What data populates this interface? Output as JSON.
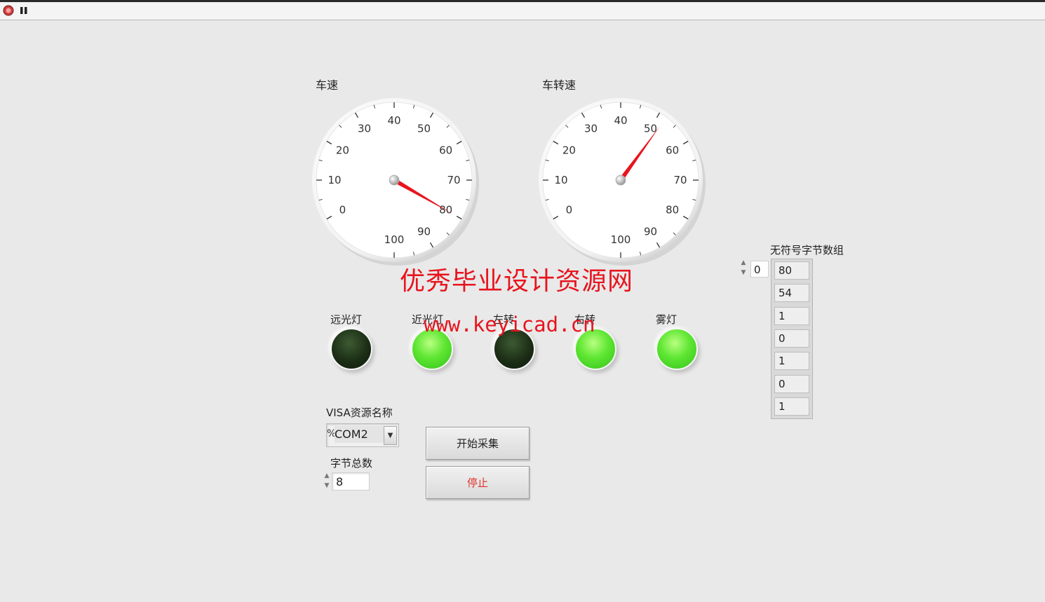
{
  "gauges": [
    {
      "id": "speed",
      "label": "车速",
      "min": 0,
      "max": 100,
      "value": 80,
      "ticks": [
        "0",
        "10",
        "20",
        "30",
        "40",
        "50",
        "60",
        "70",
        "80",
        "90",
        "100"
      ],
      "needle_color": "#e8141e"
    },
    {
      "id": "rpm",
      "label": "车转速",
      "min": 0,
      "max": 100,
      "value": 52,
      "ticks": [
        "0",
        "10",
        "20",
        "30",
        "40",
        "50",
        "60",
        "70",
        "80",
        "90",
        "100"
      ],
      "needle_color": "#e8141e"
    }
  ],
  "leds": [
    {
      "label": "远光灯",
      "state": "off"
    },
    {
      "label": "近光灯",
      "state": "on"
    },
    {
      "label": "左转",
      "state": "off"
    },
    {
      "label": "右转",
      "state": "on"
    },
    {
      "label": "雾灯",
      "state": "on"
    }
  ],
  "visa": {
    "label": "VISA资源名称",
    "prefix": "%",
    "value": "COM2"
  },
  "byte_count": {
    "label": "字节总数",
    "value": "8"
  },
  "buttons": {
    "start": "开始采集",
    "stop": "停止"
  },
  "array": {
    "label": "无符号字节数组",
    "index": "0",
    "values": [
      "80",
      "54",
      "1",
      "0",
      "1",
      "0",
      "1"
    ]
  },
  "watermark": {
    "line1": "优秀毕业设计资源网",
    "line2": "www.keyicad.cn"
  },
  "colors": {
    "led_on": "#5ee632",
    "led_off": "#1c2e16",
    "stop_text": "#e0302a",
    "watermark": "#e8141e"
  }
}
